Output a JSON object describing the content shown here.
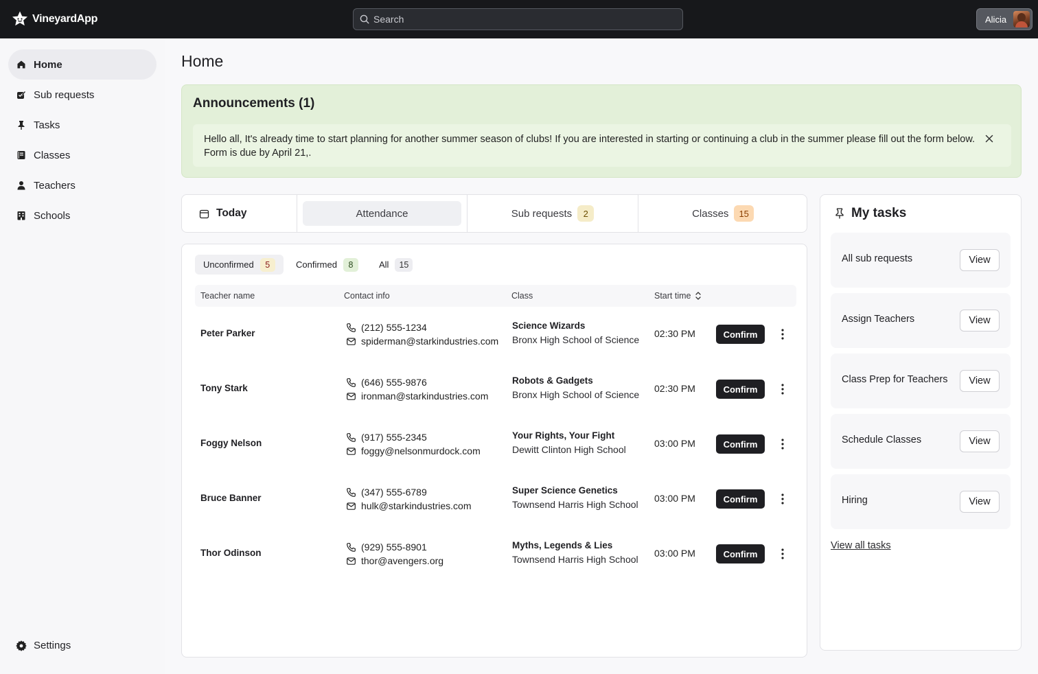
{
  "app": {
    "name": "VineyardApp"
  },
  "search": {
    "placeholder": "Search"
  },
  "user": {
    "name": "Alicia"
  },
  "sidebar": {
    "items": [
      {
        "label": "Home",
        "icon": "home-icon",
        "active": true
      },
      {
        "label": "Sub requests",
        "icon": "sub-requests-icon"
      },
      {
        "label": "Tasks",
        "icon": "pin-icon"
      },
      {
        "label": "Classes",
        "icon": "book-icon"
      },
      {
        "label": "Teachers",
        "icon": "person-icon"
      },
      {
        "label": "Schools",
        "icon": "building-icon"
      }
    ],
    "settings_label": "Settings"
  },
  "page": {
    "title": "Home"
  },
  "announcements": {
    "title": "Announcements (1)",
    "body": "Hello all, It's already time to start planning for another summer season of clubs! If you are interested in starting or continuing a club in the summer please fill out the form below. Form is due by April 21,."
  },
  "tabs": {
    "today_label": "Today",
    "items": [
      {
        "label": "Attendance",
        "badge": null,
        "active": true
      },
      {
        "label": "Sub requests",
        "badge": "2"
      },
      {
        "label": "Classes",
        "badge": "15"
      }
    ]
  },
  "filters": [
    {
      "label": "Unconfirmed",
      "count": "5",
      "active": true
    },
    {
      "label": "Confirmed",
      "count": "8"
    },
    {
      "label": "All",
      "count": "15"
    }
  ],
  "table": {
    "headers": [
      "Teacher name",
      "Contact info",
      "Class",
      "Start time"
    ],
    "confirm_label": "Confirm",
    "rows": [
      {
        "name": "Peter Parker",
        "phone": "(212) 555-1234",
        "email": "spiderman@starkindustries.com",
        "class": "Science Wizards",
        "school": "Bronx High School of Science",
        "start": "02:30 PM"
      },
      {
        "name": "Tony Stark",
        "phone": "(646) 555-9876",
        "email": "ironman@starkindustries.com",
        "class": "Robots & Gadgets",
        "school": "Bronx High School of Science",
        "start": "02:30 PM"
      },
      {
        "name": "Foggy Nelson",
        "phone": "(917) 555-2345",
        "email": "foggy@nelsonmurdock.com",
        "class": "Your Rights, Your Fight",
        "school": "Dewitt Clinton High School",
        "start": "03:00 PM"
      },
      {
        "name": "Bruce Banner",
        "phone": "(347) 555-6789",
        "email": "hulk@starkindustries.com",
        "class": "Super Science Genetics",
        "school": "Townsend Harris High School",
        "start": "03:00 PM"
      },
      {
        "name": "Thor Odinson",
        "phone": "(929) 555-8901",
        "email": "thor@avengers.org",
        "class": "Myths, Legends & Lies",
        "school": "Townsend Harris High School",
        "start": "03:00 PM"
      }
    ]
  },
  "my_tasks": {
    "title": "My tasks",
    "view_label": "View",
    "items": [
      {
        "label": "All sub requests"
      },
      {
        "label": "Assign Teachers"
      },
      {
        "label": "Class Prep for Teachers"
      },
      {
        "label": "Schedule Classes"
      },
      {
        "label": "Hiring"
      }
    ],
    "view_all_label": "View all tasks"
  },
  "colors": {
    "topbar": "#17181b",
    "announcement_bg": "#e3f0d9",
    "confirm_button": "#1f1f23",
    "badge_orange": "#fcd9b2",
    "badge_yellow": "#f5ecc8"
  }
}
